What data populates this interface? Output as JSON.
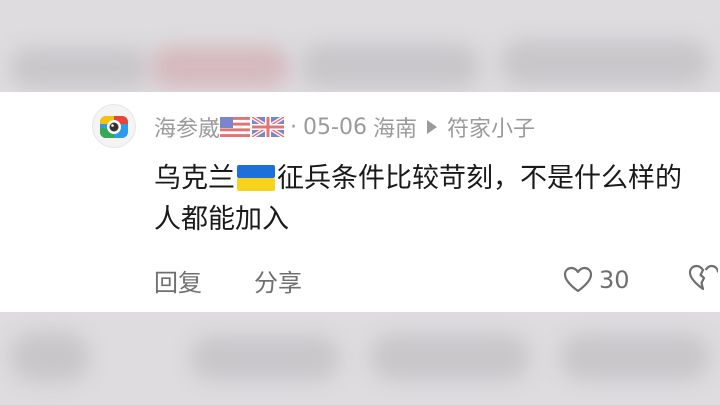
{
  "comment": {
    "username": "海参崴",
    "separator": "·",
    "date": "05-06",
    "location": "海南",
    "reply_to": "符家小子",
    "text_part1": "乌克兰",
    "text_part2": "征兵条件比较苛刻，不是什么样的人都能加入",
    "actions": {
      "reply_label": "回复",
      "share_label": "分享",
      "like_count": "30"
    },
    "icons": {
      "avatar": "camera-app-icon",
      "like": "heart-outline-icon",
      "dislike": "broken-heart-icon",
      "arrow": "triangle-right-icon"
    },
    "colors": {
      "meta_text": "#9a9a9a",
      "body_text": "#1a1a1a",
      "action_text": "#6f6f6f",
      "card_bg": "#ffffff",
      "backdrop": "#dedcdf"
    }
  }
}
